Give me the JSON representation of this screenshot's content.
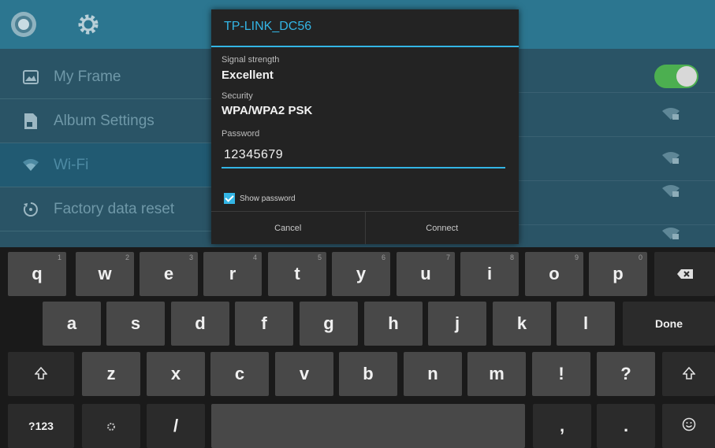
{
  "topbar": {
    "left_icons": [
      "circle-icon",
      "gear-icon"
    ]
  },
  "menu": {
    "items": [
      {
        "label": "My Frame",
        "icon": "picture-icon"
      },
      {
        "label": "Album Settings",
        "icon": "document-icon"
      },
      {
        "label": "Wi-Fi",
        "icon": "wifi-icon",
        "active": true
      },
      {
        "label": "Factory data reset",
        "icon": "reset-icon"
      }
    ]
  },
  "wifi_toggle": {
    "state": "on"
  },
  "dialog": {
    "title": "TP-LINK_DC56",
    "signal_label": "Signal strength",
    "signal_value": "Excellent",
    "security_label": "Security",
    "security_value": "WPA/WPA2 PSK",
    "password_label": "Password",
    "password_value": "12345679",
    "show_password_label": "Show password",
    "show_password_checked": true,
    "cancel_label": "Cancel",
    "connect_label": "Connect"
  },
  "keyboard": {
    "row1": [
      {
        "key": "q",
        "hint": "1"
      },
      {
        "key": "w",
        "hint": "2"
      },
      {
        "key": "e",
        "hint": "3"
      },
      {
        "key": "r",
        "hint": "4"
      },
      {
        "key": "t",
        "hint": "5"
      },
      {
        "key": "y",
        "hint": "6"
      },
      {
        "key": "u",
        "hint": "7"
      },
      {
        "key": "i",
        "hint": "8"
      },
      {
        "key": "o",
        "hint": "9"
      },
      {
        "key": "p",
        "hint": "0"
      }
    ],
    "row2": [
      "a",
      "s",
      "d",
      "f",
      "g",
      "h",
      "j",
      "k",
      "l"
    ],
    "row3": [
      "z",
      "x",
      "c",
      "v",
      "b",
      "n",
      "m",
      "!",
      "?"
    ],
    "done_label": "Done",
    "symbols_label": "?123",
    "slash_label": "/",
    "comma_label": ",",
    "period_label": "."
  },
  "colors": {
    "accent": "#33b5e5",
    "topbar": "#2c7690",
    "settings_bg": "#2a5466",
    "toggle_on": "#4caf50",
    "key_bg": "#484848",
    "key_dark": "#2b2b2b"
  }
}
